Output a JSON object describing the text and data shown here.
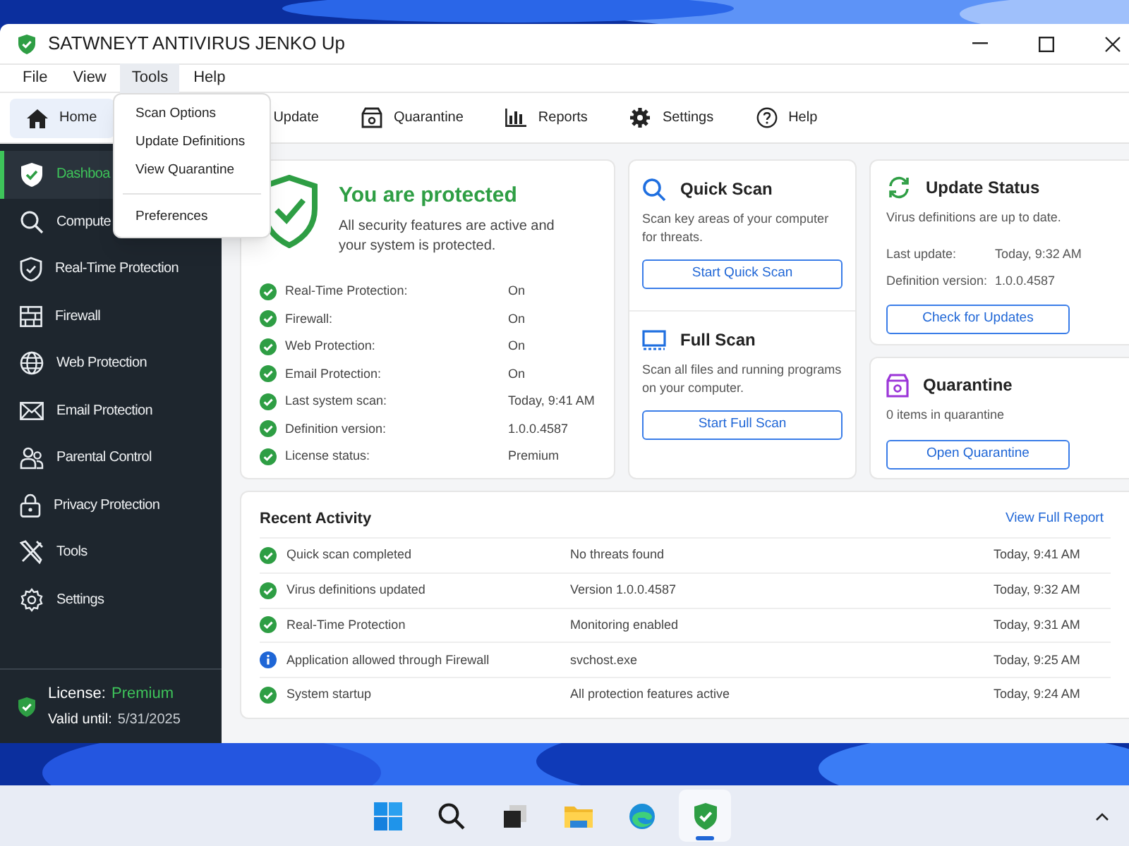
{
  "window": {
    "title": "SATWNEYT ANTIVIRUS JENKO Up"
  },
  "menu_bar": [
    {
      "label": "File",
      "selected": false
    },
    {
      "label": "View",
      "selected": false
    },
    {
      "label": "Tools",
      "selected": true
    },
    {
      "label": "Help",
      "selected": false
    }
  ],
  "tools_menu": [
    {
      "kind": "item",
      "label": "Scan Options"
    },
    {
      "kind": "item",
      "label": "Update Definitions"
    },
    {
      "kind": "item",
      "label": "View Quarantine"
    },
    {
      "kind": "separator"
    },
    {
      "kind": "item",
      "label": "Preferences"
    }
  ],
  "toolbar": [
    {
      "kind": "home",
      "label": "Home",
      "selected": true
    },
    {
      "kind": "update",
      "label": "Update",
      "selected": false
    },
    {
      "kind": "quarantine",
      "label": "Quarantine",
      "selected": false
    },
    {
      "kind": "reports",
      "label": "Reports",
      "selected": false
    },
    {
      "kind": "settings",
      "label": "Settings",
      "selected": false
    },
    {
      "kind": "help",
      "label": "Help",
      "selected": false
    }
  ],
  "sidebar": {
    "items": [
      {
        "kind": "shield",
        "label": "Dashboa",
        "selected": true
      },
      {
        "kind": "search",
        "label": "Compute",
        "selected": false
      },
      {
        "kind": "shield-outline",
        "label": "Real-Time Protection",
        "selected": false
      },
      {
        "kind": "firewall",
        "label": "Firewall",
        "selected": false
      },
      {
        "kind": "globe",
        "label": "Web Protection",
        "selected": false
      },
      {
        "kind": "mail",
        "label": "Email Protection",
        "selected": false
      },
      {
        "kind": "people",
        "label": "Parental Control",
        "selected": false
      },
      {
        "kind": "lock",
        "label": "Privacy Protection",
        "selected": false
      },
      {
        "kind": "tools",
        "label": "Tools",
        "selected": false
      },
      {
        "kind": "gear",
        "label": "Settings",
        "selected": false
      }
    ],
    "license": {
      "label": "License:",
      "value": "Premium",
      "valid_label": "Valid until:",
      "valid_date": "5/31/2025"
    }
  },
  "protection": {
    "title": "You are protected",
    "description": "All security features are active and your system is protected.",
    "rows": [
      {
        "label": "Real-Time Protection:",
        "value": "On"
      },
      {
        "label": "Firewall:",
        "value": "On"
      },
      {
        "label": "Web Protection:",
        "value": "On"
      },
      {
        "label": "Email Protection:",
        "value": "On"
      },
      {
        "label": "Last system scan:",
        "value": "Today, 9:41 AM"
      },
      {
        "label": "Definition version:",
        "value": "1.0.0.4587"
      },
      {
        "label": "License status:",
        "value": "Premium"
      }
    ]
  },
  "quick_scan": {
    "title": "Quick Scan",
    "description": "Scan key areas of your computer for threats.",
    "button": "Start Quick Scan"
  },
  "full_scan": {
    "title": "Full Scan",
    "description": "Scan all files and running programs on your computer.",
    "button": "Start Full Scan"
  },
  "update_status": {
    "title": "Update Status",
    "description": "Virus definitions are up to date.",
    "rows": [
      {
        "label": "Last update:",
        "value": "Today, 9:32 AM"
      },
      {
        "label": "Definition version:",
        "value": "1.0.0.4587"
      }
    ],
    "button": "Check for Updates"
  },
  "quarantine": {
    "title": "Quarantine",
    "description": "0 items in quarantine",
    "button": "Open Quarantine"
  },
  "recent_activity": {
    "title": "Recent Activity",
    "link": "View Full Report",
    "rows": [
      {
        "kind": "success",
        "event": "Quick scan completed",
        "detail": "No threats found",
        "time": "Today, 9:41 AM"
      },
      {
        "kind": "success",
        "event": "Virus definitions updated",
        "detail": "Version 1.0.0.4587",
        "time": "Today, 9:32 AM"
      },
      {
        "kind": "success",
        "event": "Real-Time Protection",
        "detail": "Monitoring enabled",
        "time": "Today, 9:31 AM"
      },
      {
        "kind": "info",
        "event": "Application allowed through Firewall",
        "detail": "svchost.exe",
        "time": "Today, 9:25 AM"
      },
      {
        "kind": "success",
        "event": "System startup",
        "detail": "All protection features active",
        "time": "Today, 9:24 AM"
      }
    ]
  },
  "taskbar": {
    "apps": [
      {
        "kind": "start",
        "selected": false
      },
      {
        "kind": "search",
        "selected": false
      },
      {
        "kind": "taskview",
        "selected": false
      },
      {
        "kind": "explorer",
        "selected": false
      },
      {
        "kind": "browser",
        "selected": false
      },
      {
        "kind": "antivirus",
        "selected": true
      }
    ]
  }
}
